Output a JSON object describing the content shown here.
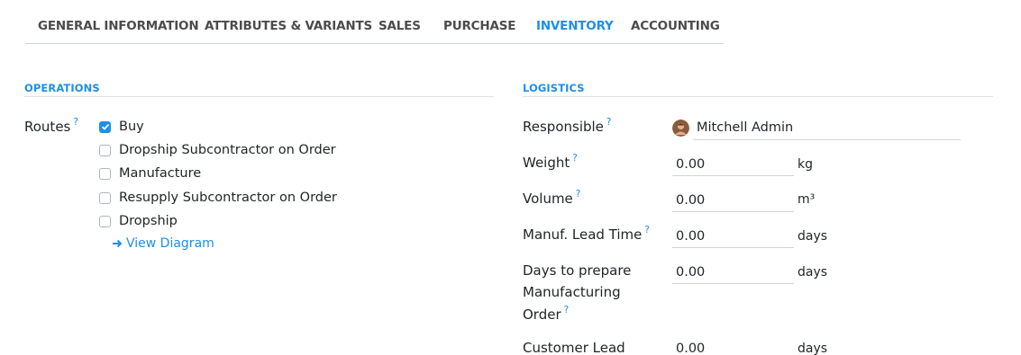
{
  "tabs": [
    {
      "label": "GENERAL INFORMATION",
      "active": false
    },
    {
      "label": "ATTRIBUTES & VARIANTS",
      "active": false
    },
    {
      "label": "SALES",
      "active": false
    },
    {
      "label": "PURCHASE",
      "active": false
    },
    {
      "label": "INVENTORY",
      "active": true
    },
    {
      "label": "ACCOUNTING",
      "active": false
    }
  ],
  "operations": {
    "title": "OPERATIONS",
    "routes_label": "Routes",
    "help_mark": "?",
    "routes": [
      {
        "label": "Buy",
        "checked": true
      },
      {
        "label": "Dropship Subcontractor on Order",
        "checked": false
      },
      {
        "label": "Manufacture",
        "checked": false
      },
      {
        "label": "Resupply Subcontractor on Order",
        "checked": false
      },
      {
        "label": "Dropship",
        "checked": false
      }
    ],
    "view_diagram": "View Diagram"
  },
  "logistics": {
    "title": "LOGISTICS",
    "responsible": {
      "label": "Responsible",
      "value": "Mitchell Admin"
    },
    "weight": {
      "label": "Weight",
      "value": "0.00",
      "unit": "kg"
    },
    "volume": {
      "label": "Volume",
      "value": "0.00",
      "unit": "m³"
    },
    "manuf_lead_time": {
      "label": "Manuf. Lead Time",
      "value": "0.00",
      "unit": "days"
    },
    "days_to_prepare": {
      "label_line1": "Days to prepare",
      "label_line2": "Manufacturing",
      "label_line3": "Order",
      "value": "0.00",
      "unit": "days"
    },
    "customer_lead": {
      "label": "Customer Lead",
      "value": "0.00",
      "unit": "days"
    }
  },
  "colors": {
    "accent": "#1f8ee8",
    "text": "#212529",
    "tab_text": "#4c4c4c",
    "rule": "#dee2e6"
  }
}
